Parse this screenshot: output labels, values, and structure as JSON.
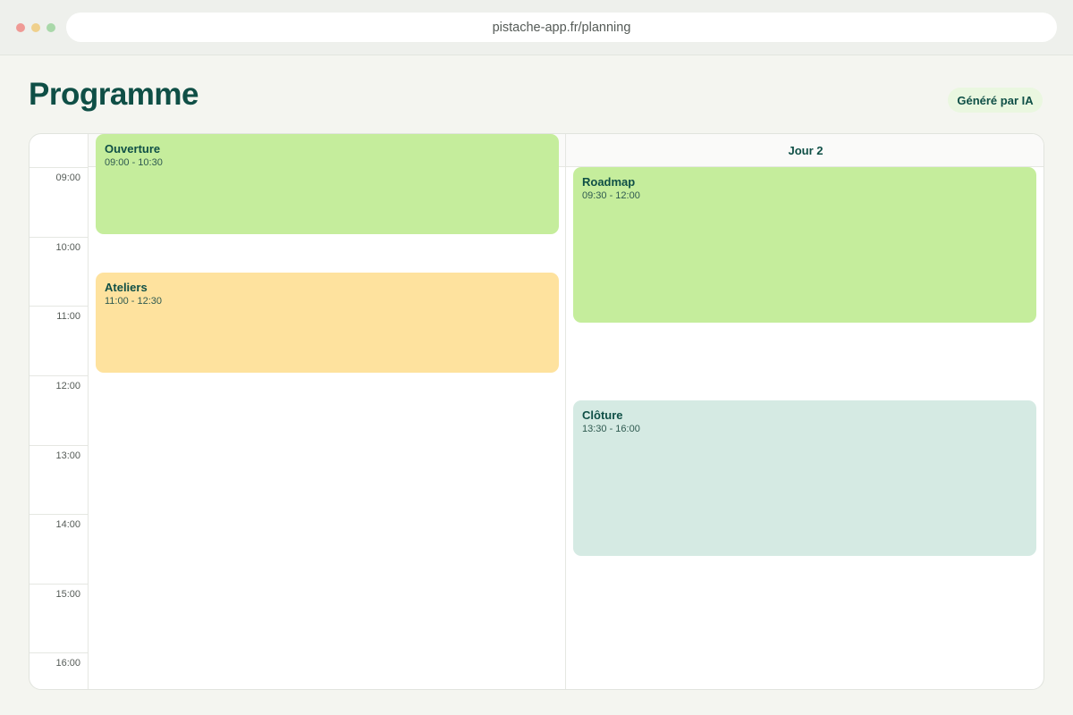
{
  "browser": {
    "url": "pistache-app.fr/planning"
  },
  "page": {
    "title": "Programme",
    "badge": "Généré par IA"
  },
  "calendar": {
    "times": [
      "09:00",
      "10:00",
      "11:00",
      "12:00",
      "13:00",
      "14:00",
      "15:00",
      "16:00"
    ],
    "days": [
      {
        "header": "",
        "events": [
          {
            "title": "Ouverture",
            "time": "09:00 - 10:30",
            "color": "#c5ed9c"
          },
          {
            "title": "Ateliers",
            "time": "11:00 - 12:30",
            "color": "#fee29e"
          }
        ]
      },
      {
        "header": "Jour 2",
        "events": [
          {
            "title": "Roadmap",
            "time": "09:30 - 12:00",
            "color": "#c5ed9c"
          },
          {
            "title": "Clôture",
            "time": "13:30 - 16:00",
            "color": "#d5eae3"
          }
        ]
      }
    ]
  },
  "colors": {
    "accent": "#0f4f46",
    "background": "#f4f5f0",
    "badge_bg": "#eaf7e0"
  }
}
